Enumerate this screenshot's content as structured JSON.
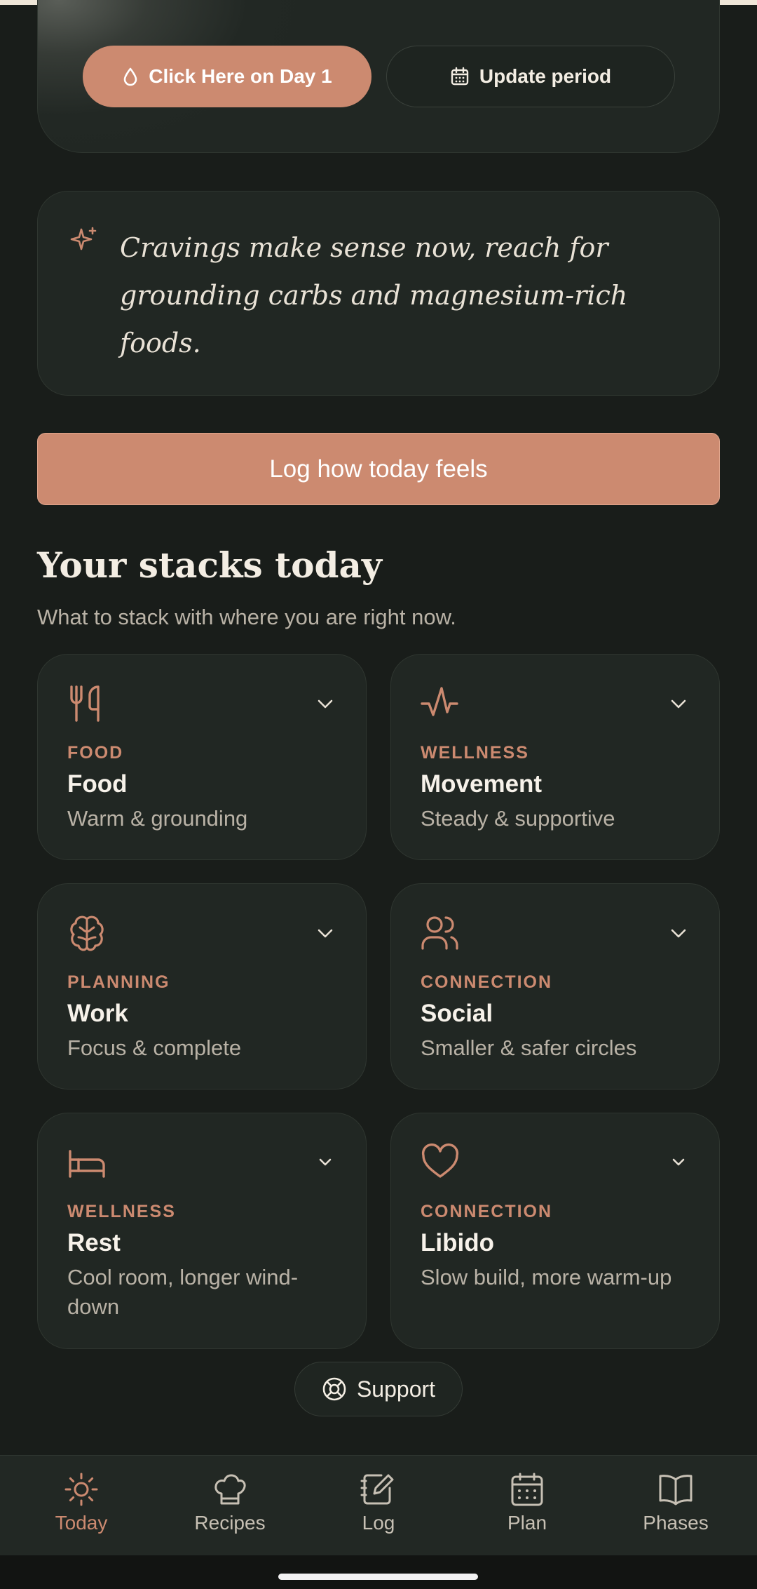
{
  "hero": {
    "primary_button": "Click Here on Day 1",
    "secondary_button": "Update period"
  },
  "insight": {
    "text": "Cravings make sense now, reach for grounding carbs and magnesium-rich foods."
  },
  "log_button": "Log how today feels",
  "stacks": {
    "title": "Your stacks today",
    "subtitle": "What to stack with where you are right now.",
    "cards": [
      {
        "category": "FOOD",
        "name": "Food",
        "desc": "Warm & grounding",
        "icon": "utensils-icon"
      },
      {
        "category": "WELLNESS",
        "name": "Movement",
        "desc": "Steady & supportive",
        "icon": "activity-icon"
      },
      {
        "category": "PLANNING",
        "name": "Work",
        "desc": "Focus & complete",
        "icon": "brain-icon"
      },
      {
        "category": "CONNECTION",
        "name": "Social",
        "desc": "Smaller & safer circles",
        "icon": "users-icon"
      },
      {
        "category": "WELLNESS",
        "name": "Rest",
        "desc": "Cool room, longer wind-down",
        "icon": "bed-icon"
      },
      {
        "category": "CONNECTION",
        "name": "Libido",
        "desc": "Slow build, more warm-up",
        "icon": "heart-icon"
      }
    ]
  },
  "support_label": "Support",
  "nav": {
    "items": [
      {
        "label": "Today",
        "icon": "sun-icon",
        "active": true
      },
      {
        "label": "Recipes",
        "icon": "chef-hat-icon"
      },
      {
        "label": "Log",
        "icon": "notebook-pen-icon"
      },
      {
        "label": "Plan",
        "icon": "calendar-icon"
      },
      {
        "label": "Phases",
        "icon": "book-open-icon"
      }
    ]
  },
  "colors": {
    "accent": "#cc8a70",
    "background": "#191d1a",
    "card": "#212723"
  }
}
